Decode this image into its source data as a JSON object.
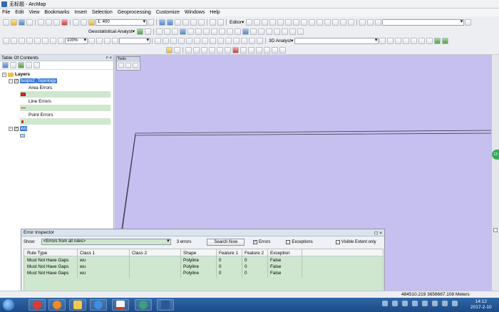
{
  "window": {
    "title": "无标题 - ArcMap"
  },
  "menu": [
    "File",
    "Edit",
    "View",
    "Bookmarks",
    "Insert",
    "Selection",
    "Geoprocessing",
    "Customize",
    "Windows",
    "Help"
  ],
  "toolbar": {
    "scale_value": "1: 400",
    "editor_label": "Editor▾",
    "geostatistical_label": "Geostatistical Analyst▾",
    "zoom_value": "100%",
    "analyst3d_label": "3D Analyst▾"
  },
  "toc": {
    "title": "Table Of Contents",
    "pin": "ᵖ ×",
    "layers_label": "Layers",
    "items": [
      {
        "label": "tuopo2_Topology",
        "selected": true
      },
      {
        "label": "Area Errors"
      },
      {
        "label": "Line Errors"
      },
      {
        "label": "Point Errors"
      },
      {
        "label": "wu"
      }
    ]
  },
  "tools_float": {
    "title": "Tools"
  },
  "error_inspector": {
    "title": "Error Inspector",
    "show_label": "Show:",
    "show_value": "<Errors from all rules>",
    "count": "3 errors",
    "search_button": "Search Now",
    "errors_check": "Errors",
    "exceptions_check": "Exceptions",
    "visible_extent_check": "Visible Extent only",
    "columns": [
      "Rule Type",
      "Class 1",
      "Class 2",
      "Shape",
      "Feature 1",
      "Feature 2",
      "Exception"
    ],
    "rows": [
      [
        "Must Not Have Gaps",
        "wu",
        "",
        "Polyline",
        "0",
        "0",
        "False"
      ],
      [
        "Must Not Have Gaps",
        "wu",
        "",
        "Polyline",
        "0",
        "0",
        "False"
      ],
      [
        "Must Not Have Gaps",
        "wu",
        "",
        "Polyline",
        "0",
        "0",
        "False"
      ]
    ]
  },
  "status": {
    "coords": "484510.219  3656667.108 Meters"
  },
  "clock": {
    "time": "14:12",
    "date": "2017-2-10"
  }
}
